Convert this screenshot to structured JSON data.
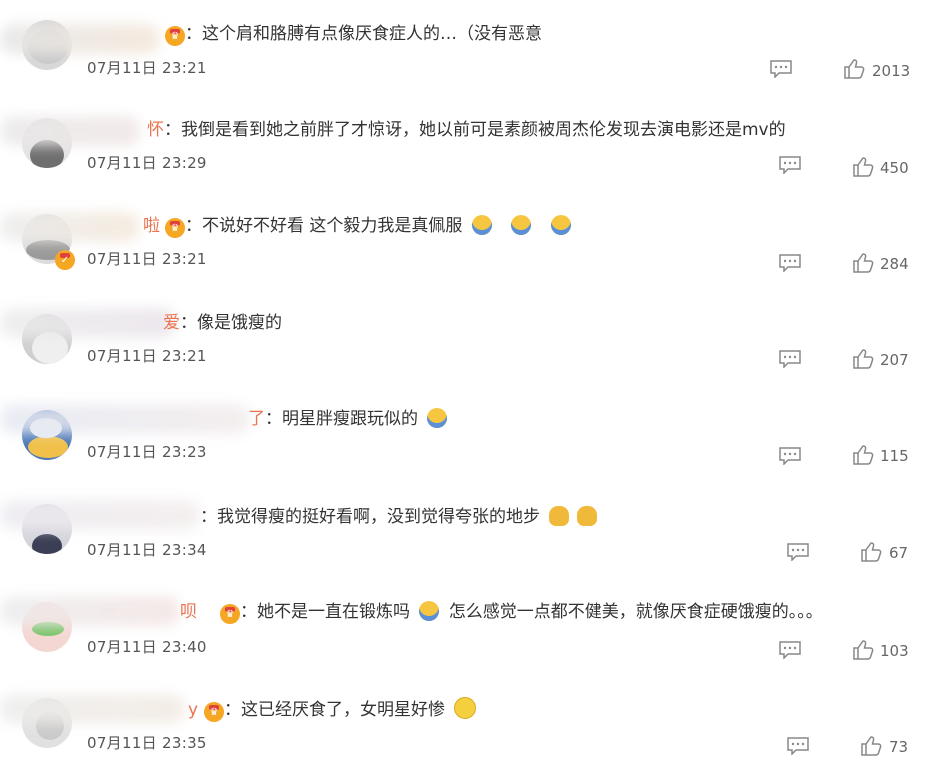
{
  "comments": [
    {
      "text": "这个肩和胳膊有点像厌食症人的…（没有恶意",
      "time": "07月11日 23:21",
      "likes": "2013",
      "vip": true,
      "emojis": []
    },
    {
      "text": "我倒是看到她之前胖了才惊讶，她以前可是素颜被周杰伦发现去演电影还是mv的",
      "time": "07月11日 23:29",
      "likes": "450",
      "vip": false,
      "name_fragment": "怀",
      "emojis": []
    },
    {
      "text": "不说好不好看 这个毅力我是真佩服",
      "time": "07月11日 23:21",
      "likes": "284",
      "vip": true,
      "verified": true,
      "name_fragment": "啦",
      "emojis": [
        "emoji-sad",
        "emoji-sad",
        "emoji-sad"
      ]
    },
    {
      "text": "像是饿瘦的",
      "time": "07月11日 23:21",
      "likes": "207",
      "vip": false,
      "name_fragment": "爱",
      "emojis": []
    },
    {
      "text": "明星胖瘦跟玩似的",
      "time": "07月11日 23:23",
      "likes": "115",
      "vip": false,
      "name_fragment": "了",
      "emojis": [
        "emoji-sad"
      ]
    },
    {
      "text": "我觉得瘦的挺好看啊，没到觉得夸张的地步",
      "time": "07月11日 23:34",
      "likes": "67",
      "vip": false,
      "emojis": [
        "pray",
        "pray"
      ]
    },
    {
      "text_a": "她不是一直在锻炼吗",
      "text_b": "怎么感觉一点都不健美，就像厌食症硬饿瘦的。。。",
      "time": "07月11日 23:40",
      "likes": "103",
      "vip": true,
      "name_fragment": "呗",
      "emojis": [
        "emoji-sad"
      ]
    },
    {
      "text": "这已经厌食了，女明星好惨",
      "time": "07月11日 23:35",
      "likes": "73",
      "vip": true,
      "name_fragment": "y",
      "emojis": [
        "laugh"
      ]
    }
  ],
  "ui": {
    "colon": "：",
    "reply_icon": "comment-icon",
    "like_icon": "thumbs-up-icon",
    "accent": "#f5a623",
    "text_color": "#333333",
    "meta_color": "#666666"
  }
}
